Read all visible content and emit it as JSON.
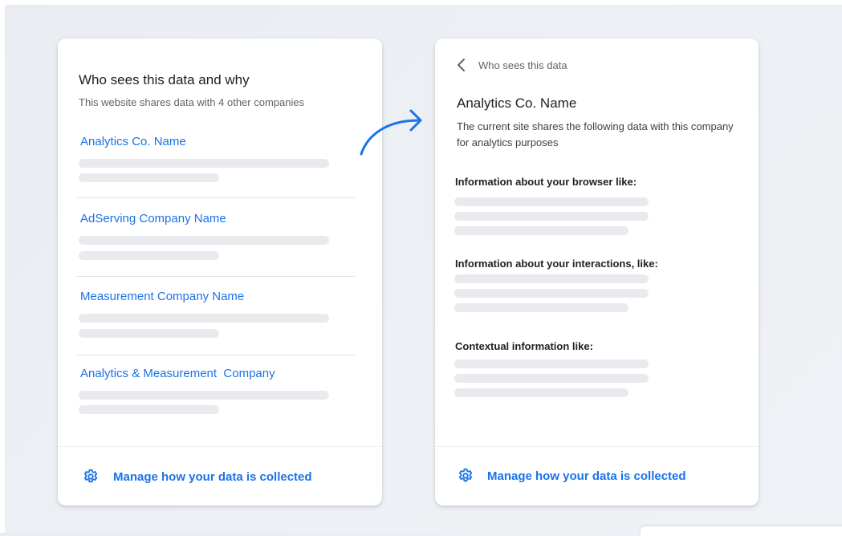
{
  "left_panel": {
    "title": "Who sees this data and why",
    "subtitle": "This website shares data with 4 other companies",
    "companies": [
      {
        "name": "Analytics Co. Name"
      },
      {
        "name": "AdServing Company Name"
      },
      {
        "name": "Measurement Company Name"
      },
      {
        "name": "Analytics & Measurement  Company"
      }
    ],
    "footer_link": "Manage how your data is collected"
  },
  "right_panel": {
    "back_label": "Who sees this data",
    "title": "Analytics Co. Name",
    "description": "The current site shares the following data with this company for analytics purposes",
    "sections": [
      {
        "heading": "Information about your browser like:"
      },
      {
        "heading": "Information about your interactions, like:"
      },
      {
        "heading": "Contextual information like:"
      }
    ],
    "footer_link": "Manage how your data is collected"
  },
  "icons": {
    "footer": "gear-icon",
    "back": "chevron-left-icon",
    "transition": "curved-arrow-icon"
  },
  "colors": {
    "link": "#1a73e8",
    "placeholder": "#e8eaed",
    "background": "#eceff3"
  }
}
